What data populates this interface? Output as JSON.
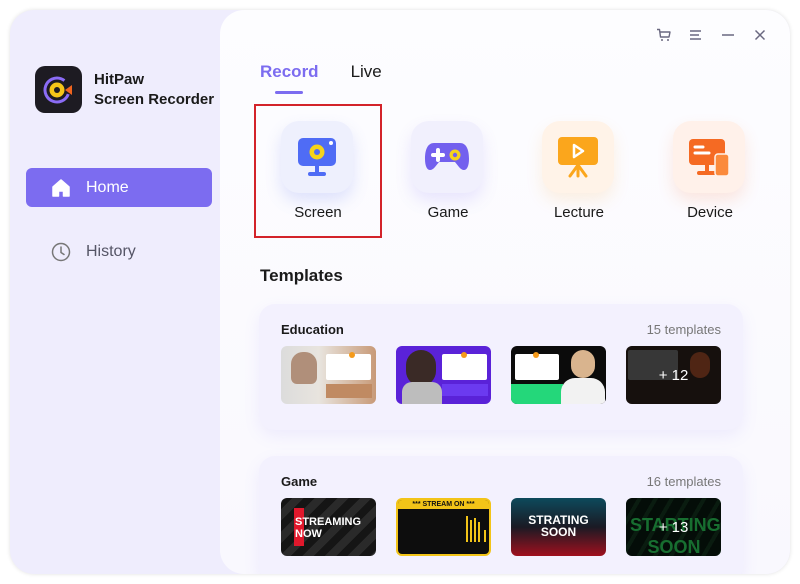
{
  "app": {
    "name_line1": "HitPaw",
    "name_line2": "Screen Recorder"
  },
  "sidebar": {
    "items": [
      {
        "label": "Home",
        "icon": "home-icon",
        "active": true
      },
      {
        "label": "History",
        "icon": "clock-icon",
        "active": false
      }
    ]
  },
  "window_controls": [
    "cart-icon",
    "menu-icon",
    "minimize-icon",
    "close-icon"
  ],
  "tabs": [
    {
      "label": "Record",
      "active": true
    },
    {
      "label": "Live",
      "active": false
    }
  ],
  "modes": [
    {
      "label": "Screen",
      "icon": "monitor-camera-icon",
      "selected": true
    },
    {
      "label": "Game",
      "icon": "gamepad-icon",
      "selected": false
    },
    {
      "label": "Lecture",
      "icon": "presentation-icon",
      "selected": false
    },
    {
      "label": "Device",
      "icon": "device-icon",
      "selected": false
    }
  ],
  "templates": {
    "title": "Templates",
    "categories": [
      {
        "name": "Education",
        "count_label": "15 templates",
        "thumbnails": [
          {
            "caption": "",
            "more": ""
          },
          {
            "caption": "",
            "more": ""
          },
          {
            "caption": "",
            "more": ""
          },
          {
            "caption": "",
            "more": "+ 12"
          }
        ]
      },
      {
        "name": "Game",
        "count_label": "16 templates",
        "thumbnails": [
          {
            "caption": "STREAMING NOW",
            "more": ""
          },
          {
            "caption": "*** STREAM ON ***",
            "more": ""
          },
          {
            "caption": "STRATING SOON",
            "more": ""
          },
          {
            "caption": "STARTING SOON",
            "more": "+ 13"
          }
        ]
      }
    ]
  },
  "colors": {
    "accent": "#7c6cf0",
    "sidebar_bg": "#efedfd",
    "selection_outline": "#d3232a"
  }
}
